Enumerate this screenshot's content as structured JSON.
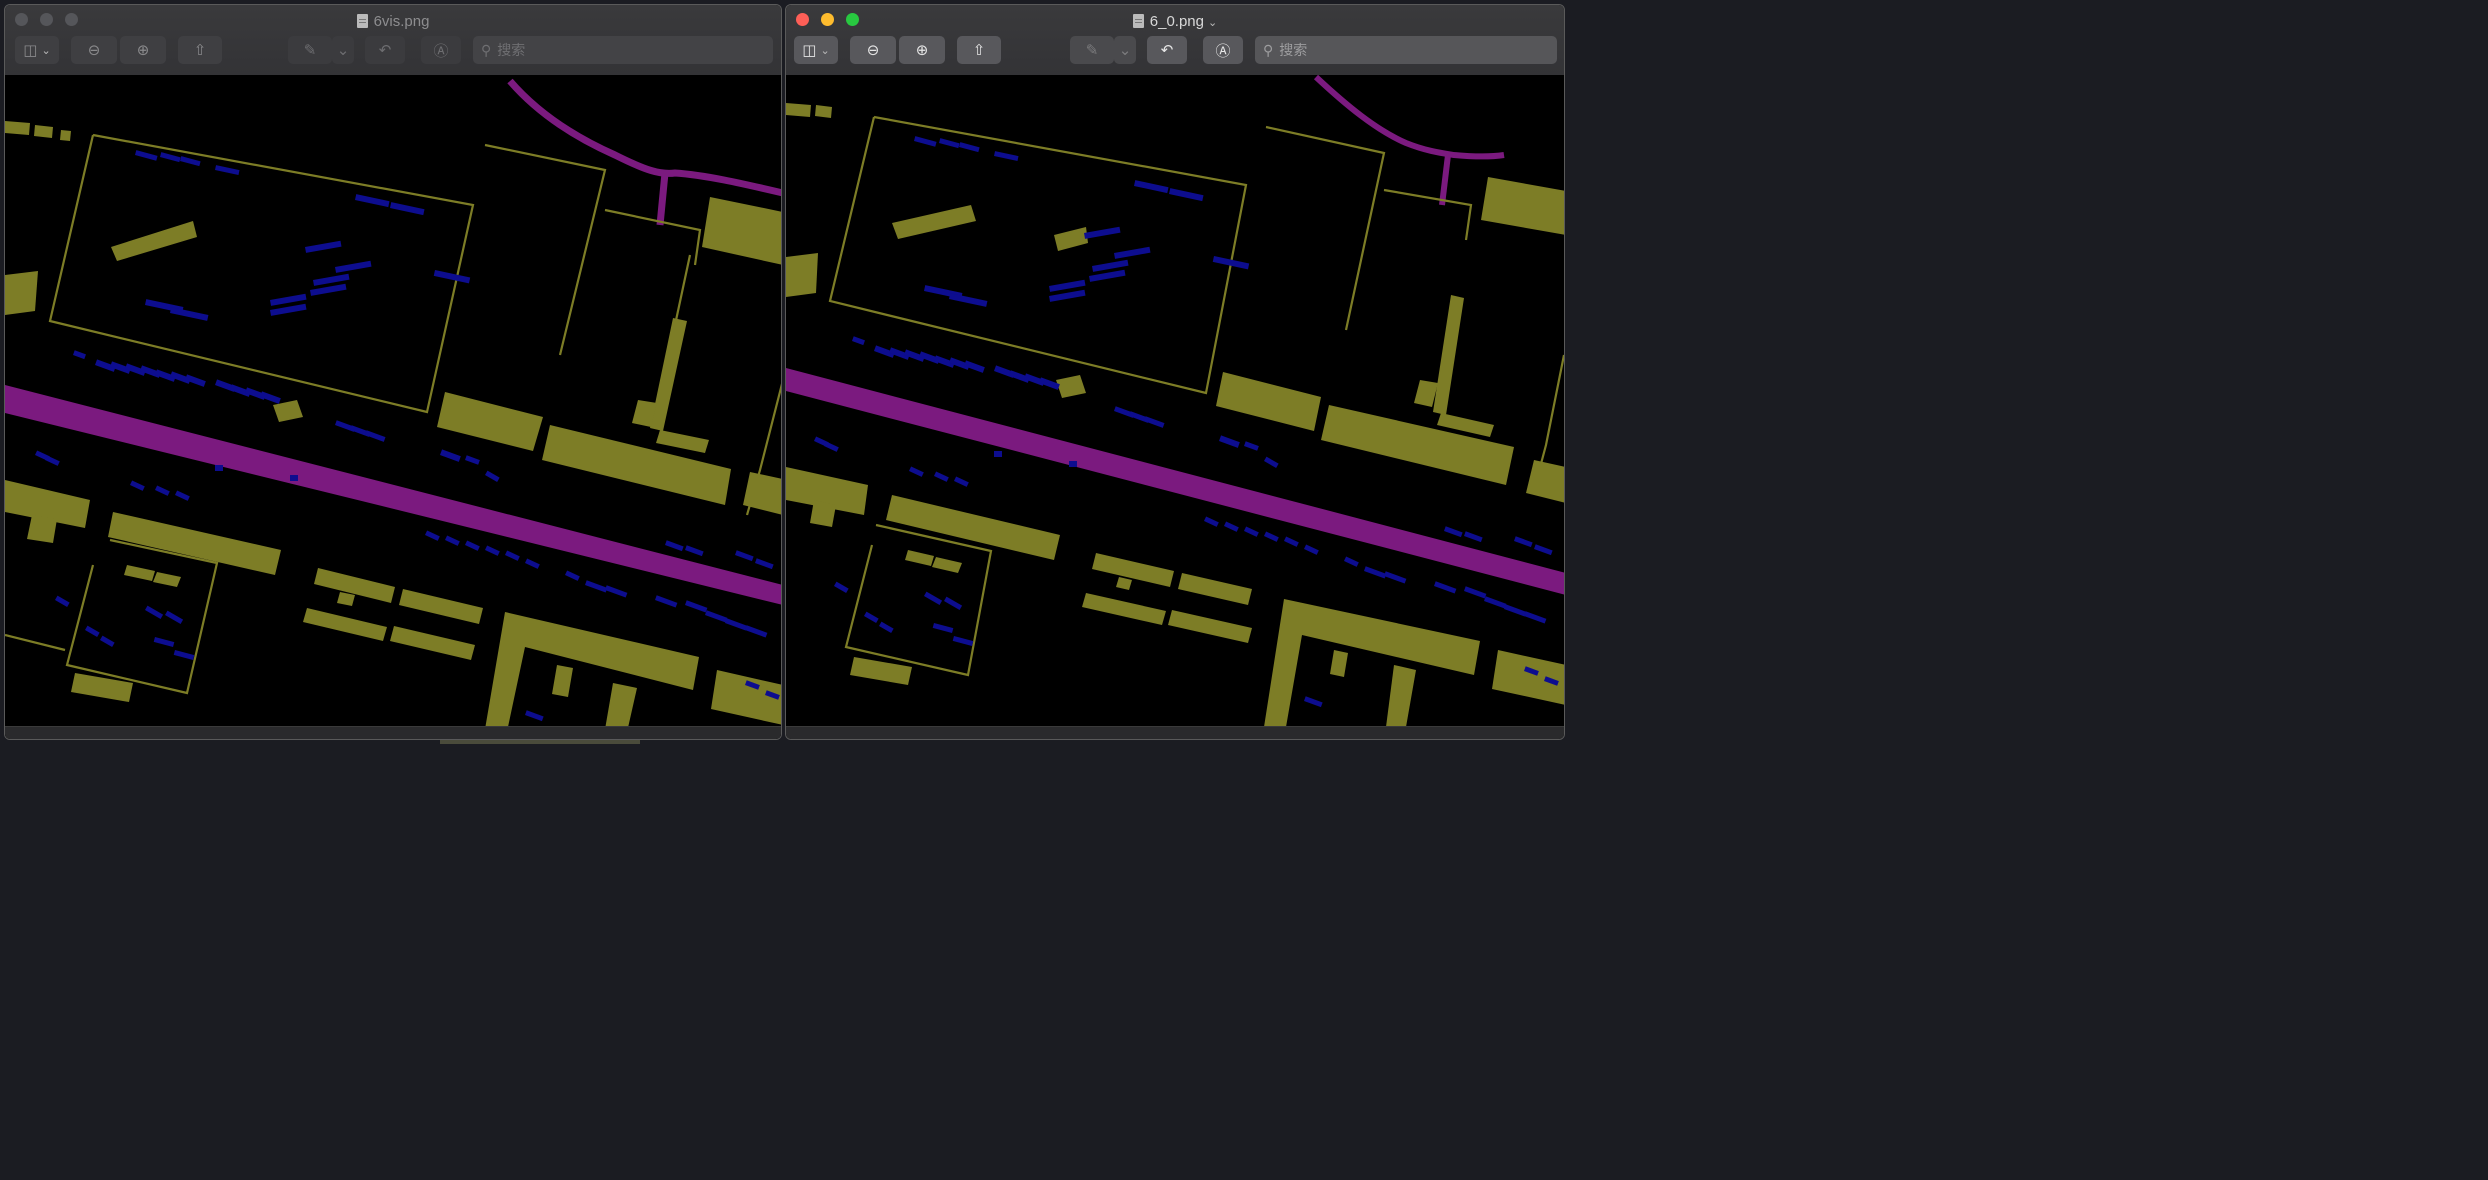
{
  "left_window": {
    "title": "6vis.png",
    "search_placeholder": "搜索",
    "active": false
  },
  "right_window": {
    "title": "6_0.png",
    "search_placeholder": "搜索",
    "active": true
  },
  "toolbar_icons": {
    "sidebar": "sidebar-icon",
    "zoom_out": "zoom-out-icon",
    "zoom_in": "zoom-in-icon",
    "share": "share-icon",
    "markup": "pen-icon",
    "rotate": "rotate-icon",
    "annotate": "markup-icon",
    "search": "search-icon"
  },
  "colors": {
    "background": "#000000",
    "building": "#7d7d26",
    "small_structure": "#0d0d8f",
    "road": "#7b1a7f",
    "outline": "#7d7d26"
  }
}
